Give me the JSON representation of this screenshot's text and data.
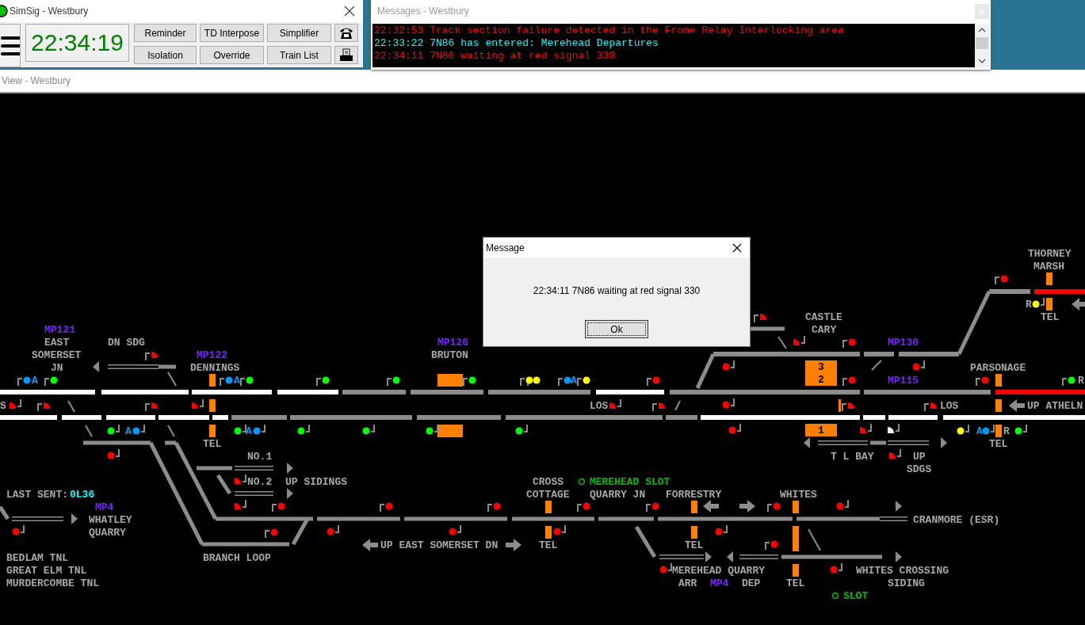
{
  "simsig": {
    "title": "SimSig - Westbury",
    "clock": "22:34:19",
    "buttons": [
      "Reminder",
      "TD Interpose",
      "Simplifier",
      "Isolation",
      "Override",
      "Train List"
    ]
  },
  "messages": {
    "title": "Messages - Westbury",
    "lines": [
      {
        "text": "22:32:53 Track section failure detected in the Frome Relay Interlocking area",
        "color": "#ff0000"
      },
      {
        "text": "22:33:22 7N86 has entered: Merehead Departures",
        "color": "#00ffff"
      },
      {
        "text": "22:34:11 7N86 waiting at red signal 330",
        "color": "#ff0000"
      }
    ]
  },
  "view": {
    "title": "View - Westbury"
  },
  "diagram": {
    "labels": [
      {
        "text": "THORNEY",
        "kind": "location"
      },
      {
        "text": "MARSH",
        "kind": "location"
      },
      {
        "text": "R",
        "kind": "location"
      },
      {
        "text": "CASTLE",
        "kind": "location"
      },
      {
        "text": "TEL",
        "kind": "location"
      },
      {
        "text": "MP121",
        "kind": "milepost"
      },
      {
        "text": "CARY",
        "kind": "location"
      },
      {
        "text": "EAST",
        "kind": "location"
      },
      {
        "text": "DN SDG",
        "kind": "location"
      },
      {
        "text": "MP126",
        "kind": "milepost"
      },
      {
        "text": "MP130",
        "kind": "milepost"
      },
      {
        "text": "SOMERSET",
        "kind": "location"
      },
      {
        "text": "MP122",
        "kind": "milepost"
      },
      {
        "text": "BRUTON",
        "kind": "location"
      },
      {
        "text": "JN",
        "kind": "location"
      },
      {
        "text": "DENNINGS",
        "kind": "location"
      },
      {
        "text": "PARSONAGE",
        "kind": "location"
      },
      {
        "text": "A",
        "kind": "indicator"
      },
      {
        "text": "A",
        "kind": "indicator"
      },
      {
        "text": "A",
        "kind": "indicator"
      },
      {
        "text": "MP115",
        "kind": "milepost"
      },
      {
        "text": "R",
        "kind": "location"
      },
      {
        "text": "S",
        "kind": "location"
      },
      {
        "text": "LOS",
        "kind": "location"
      },
      {
        "text": "LOS",
        "kind": "location"
      },
      {
        "text": "UP ATHELN",
        "kind": "location"
      },
      {
        "text": "A",
        "kind": "indicator"
      },
      {
        "text": "A",
        "kind": "indicator"
      },
      {
        "text": "A",
        "kind": "indicator"
      },
      {
        "text": "R",
        "kind": "location"
      },
      {
        "text": "TEL",
        "kind": "location"
      },
      {
        "text": "TEL",
        "kind": "location"
      },
      {
        "text": "NO.1",
        "kind": "location"
      },
      {
        "text": "T L BAY",
        "kind": "location"
      },
      {
        "text": "UP",
        "kind": "location"
      },
      {
        "text": "SDGS",
        "kind": "location"
      },
      {
        "text": "NO.2",
        "kind": "location"
      },
      {
        "text": "UP SIDINGS",
        "kind": "location"
      },
      {
        "text": "CROSS",
        "kind": "location"
      },
      {
        "text": "MEREHEAD SLOT",
        "kind": "slot"
      },
      {
        "text": "LAST SENT:",
        "kind": "location"
      },
      {
        "text": "0L36",
        "kind": "td"
      },
      {
        "text": "COTTAGE",
        "kind": "location"
      },
      {
        "text": "QUARRY JN",
        "kind": "location"
      },
      {
        "text": "FORRESTRY",
        "kind": "location"
      },
      {
        "text": "WHITES",
        "kind": "location"
      },
      {
        "text": "MP4",
        "kind": "milepost"
      },
      {
        "text": "WHATLEY",
        "kind": "location"
      },
      {
        "text": "CRANMORE (ESR)",
        "kind": "location"
      },
      {
        "text": "QUARRY",
        "kind": "location"
      },
      {
        "text": "UP EAST SOMERSET DN",
        "kind": "location"
      },
      {
        "text": "TEL",
        "kind": "location"
      },
      {
        "text": "TEL",
        "kind": "location"
      },
      {
        "text": "BEDLAM TNL",
        "kind": "location"
      },
      {
        "text": "BRANCH LOOP",
        "kind": "location"
      },
      {
        "text": "GREAT ELM TNL",
        "kind": "location"
      },
      {
        "text": "MEREHEAD QUARRY",
        "kind": "location"
      },
      {
        "text": "WHITES CROSSING",
        "kind": "location"
      },
      {
        "text": "MURDERCOMBE TNL",
        "kind": "location"
      },
      {
        "text": "ARR",
        "kind": "location"
      },
      {
        "text": "MP4",
        "kind": "milepost"
      },
      {
        "text": "DEP",
        "kind": "location"
      },
      {
        "text": "TEL",
        "kind": "location"
      },
      {
        "text": "SIDING",
        "kind": "location"
      },
      {
        "text": "SLOT",
        "kind": "slot"
      }
    ],
    "signals": [
      {
        "kind": "main",
        "color": "#0099ff"
      },
      {
        "kind": "main",
        "color": "#00ff00"
      },
      {
        "kind": "shunt",
        "color": "#ff0000"
      },
      {
        "kind": "main",
        "color": "#0099ff"
      },
      {
        "kind": "main",
        "color": "#00ff00"
      },
      {
        "kind": "main",
        "color": "#00ff00"
      },
      {
        "kind": "main",
        "color": "#00ff00"
      },
      {
        "kind": "main",
        "color": "#00ff00"
      },
      {
        "kind": "main",
        "color": "#ffff00"
      },
      {
        "kind": "main",
        "color": "#ffff00"
      },
      {
        "kind": "main",
        "color": "#0099ff"
      },
      {
        "kind": "main",
        "color": "#ffff00"
      },
      {
        "kind": "main",
        "color": "#ff0000"
      },
      {
        "kind": "shunt",
        "color": "#ff0000"
      },
      {
        "kind": "shunt",
        "color": "#ff0000"
      },
      {
        "kind": "main",
        "color": "#ff0000"
      },
      {
        "kind": "main",
        "color": "#ff0000"
      },
      {
        "kind": "main",
        "color": "#ff0000"
      },
      {
        "kind": "main",
        "color": "#ffff00"
      },
      {
        "kind": "main",
        "color": "#ff0000"
      },
      {
        "kind": "main",
        "color": "#00ff00"
      },
      {
        "kind": "shunt",
        "color": "#ff0000"
      },
      {
        "kind": "shunt",
        "color": "#ff0000"
      },
      {
        "kind": "shunt",
        "color": "#ff0000"
      },
      {
        "kind": "shunt",
        "color": "#ff0000"
      },
      {
        "kind": "shunt",
        "color": "#ff0000"
      },
      {
        "kind": "shunt",
        "color": "#ff0000"
      },
      {
        "kind": "main",
        "color": "#ff0000"
      },
      {
        "kind": "main",
        "color": "#ff0000"
      },
      {
        "kind": "main",
        "color": "#ff0000"
      },
      {
        "kind": "shunt",
        "color": "#ff0000"
      },
      {
        "kind": "shunt",
        "color": "#ff0000"
      },
      {
        "kind": "main",
        "color": "#00ff00"
      },
      {
        "kind": "main",
        "color": "#0099ff"
      },
      {
        "kind": "main",
        "color": "#00ff00"
      },
      {
        "kind": "main",
        "color": "#0099ff"
      },
      {
        "kind": "main",
        "color": "#00ff00"
      },
      {
        "kind": "main",
        "color": "#00ff00"
      },
      {
        "kind": "main",
        "color": "#00ff00"
      },
      {
        "kind": "main",
        "color": "#00ff00"
      },
      {
        "kind": "main",
        "color": "#ff0000"
      },
      {
        "kind": "shunt",
        "color": "#ff0000"
      },
      {
        "kind": "shunt",
        "color": "#ffffff"
      },
      {
        "kind": "main",
        "color": "#ffff00"
      },
      {
        "kind": "main",
        "color": "#0099ff"
      },
      {
        "kind": "main",
        "color": "#00ff00"
      },
      {
        "kind": "main",
        "color": "#ff0000"
      },
      {
        "kind": "shunt",
        "color": "#ff0000"
      },
      {
        "kind": "shunt",
        "color": "#ff0000"
      },
      {
        "kind": "shunt",
        "color": "#ff0000"
      },
      {
        "kind": "main",
        "color": "#ff0000"
      },
      {
        "kind": "main",
        "color": "#ff0000"
      },
      {
        "kind": "main",
        "color": "#ff0000"
      },
      {
        "kind": "main",
        "color": "#ff0000"
      },
      {
        "kind": "main",
        "color": "#ff0000"
      },
      {
        "kind": "main",
        "color": "#ff0000"
      },
      {
        "kind": "main",
        "color": "#ff0000"
      },
      {
        "kind": "main",
        "color": "#ff0000"
      },
      {
        "kind": "main",
        "color": "#ff0000"
      },
      {
        "kind": "main",
        "color": "#ff0000"
      },
      {
        "kind": "main",
        "color": "#ff0000"
      },
      {
        "kind": "main",
        "color": "#ff0000"
      },
      {
        "kind": "main",
        "color": "#ff0000"
      },
      {
        "kind": "main",
        "color": "#ff0000"
      },
      {
        "kind": "main",
        "color": "#ff0000"
      },
      {
        "kind": "main",
        "color": "#ff0000"
      }
    ],
    "track_sections": [
      {
        "route_set": true,
        "occupied": false
      },
      {
        "route_set": true,
        "occupied": false
      },
      {
        "route_set": true,
        "occupied": false
      },
      {
        "route_set": true,
        "occupied": false
      },
      {
        "route_set": false,
        "occupied": false
      },
      {
        "route_set": false,
        "occupied": false
      },
      {
        "route_set": false,
        "occupied": false
      },
      {
        "route_set": true,
        "occupied": false
      },
      {
        "route_set": false,
        "occupied": false
      },
      {
        "route_set": false,
        "occupied": false
      },
      {
        "route_set": false,
        "occupied": true
      },
      {
        "route_set": true,
        "occupied": false
      },
      {
        "route_set": true,
        "occupied": false
      },
      {
        "route_set": true,
        "occupied": false
      },
      {
        "route_set": true,
        "occupied": false
      },
      {
        "route_set": true,
        "occupied": false
      },
      {
        "route_set": false,
        "occupied": false
      },
      {
        "route_set": false,
        "occupied": false
      },
      {
        "route_set": false,
        "occupied": false
      },
      {
        "route_set": false,
        "occupied": false
      },
      {
        "route_set": false,
        "occupied": false
      },
      {
        "route_set": true,
        "occupied": false
      },
      {
        "route_set": true,
        "occupied": false
      },
      {
        "route_set": true,
        "occupied": false
      },
      {
        "route_set": true,
        "occupied": false
      },
      {
        "route_set": false,
        "occupied": false
      },
      {
        "route_set": false,
        "occupied": false
      },
      {
        "route_set": false,
        "occupied": false
      },
      {
        "route_set": false,
        "occupied": false
      },
      {
        "route_set": false,
        "occupied": true
      }
    ],
    "berths": [
      {
        "numbers": [
          "3",
          "2"
        ]
      },
      {
        "numbers": [
          "1"
        ]
      }
    ]
  },
  "dialog": {
    "title": "Message",
    "text": "22:34:11 7N86 waiting at red signal 330",
    "button": "Ok"
  }
}
